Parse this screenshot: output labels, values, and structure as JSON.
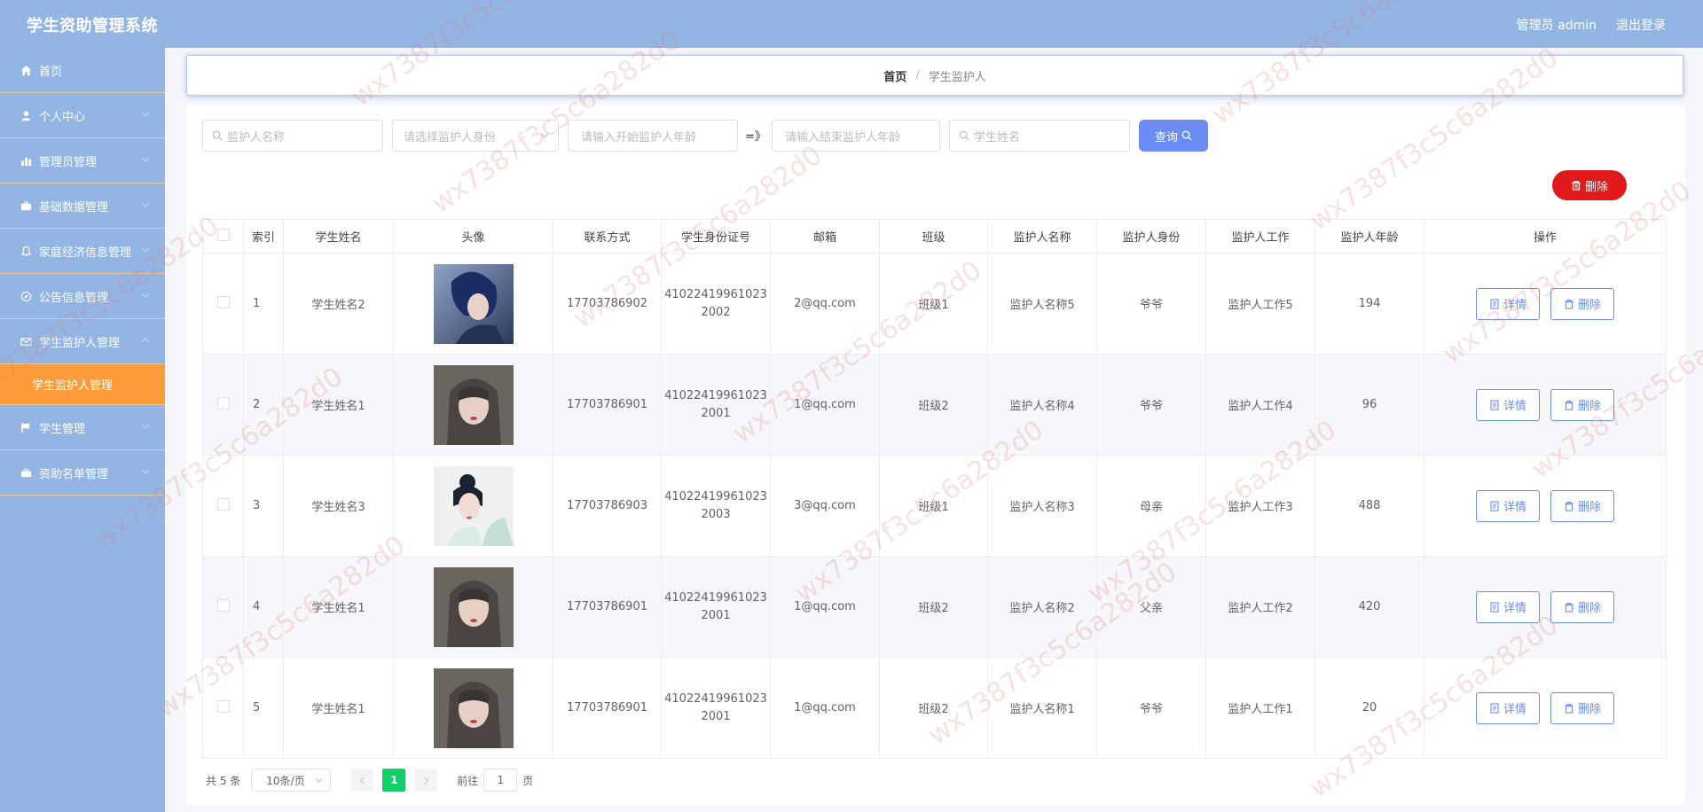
{
  "header": {
    "title": "学生资助管理系统",
    "user_label": "管理员 admin",
    "logout_label": "退出登录"
  },
  "sidebar": {
    "items": [
      {
        "label": "首页",
        "icon": "home-icon"
      },
      {
        "label": "个人中心",
        "icon": "user-icon"
      },
      {
        "label": "管理员管理",
        "icon": "bar-chart-icon"
      },
      {
        "label": "基础数据管理",
        "icon": "briefcase-icon"
      },
      {
        "label": "家庭经济信息管理",
        "icon": "bell-icon"
      },
      {
        "label": "公告信息管理",
        "icon": "compass-icon"
      },
      {
        "label": "学生监护人管理",
        "icon": "mail-icon"
      },
      {
        "label": "学生管理",
        "icon": "flag-icon"
      },
      {
        "label": "资助名单管理",
        "icon": "suitcase-icon"
      }
    ],
    "active_sub": "学生监护人管理"
  },
  "breadcrumb": {
    "home": "首页",
    "separator": "/",
    "current": "学生监护人"
  },
  "filters": {
    "guardian_name_placeholder": "监护人名称",
    "guardian_identity_placeholder": "请选择监护人身份",
    "age_start_placeholder": "请输入开始监护人年龄",
    "range_sep": "=》",
    "age_end_placeholder": "请输入结束监护人年龄",
    "student_name_placeholder": "学生姓名",
    "query_label": "查询"
  },
  "delete_label": "删除",
  "table": {
    "headers": [
      "索引",
      "学生姓名",
      "头像",
      "联系方式",
      "学生身份证号",
      "邮箱",
      "班级",
      "监护人名称",
      "监护人身份",
      "监护人工作",
      "监护人年龄",
      "操作"
    ],
    "detail_label": "详情",
    "delete_label": "删除",
    "rows": [
      {
        "index": "1",
        "student": "学生姓名2",
        "phone": "17703786902",
        "id_line1": "41022419961023",
        "id_line2": "2002",
        "email": "2@qq.com",
        "class": "班级1",
        "guardian": "监护人名称5",
        "identity": "爷爷",
        "job": "监护人工作5",
        "age": "194"
      },
      {
        "index": "2",
        "student": "学生姓名1",
        "phone": "17703786901",
        "id_line1": "41022419961023",
        "id_line2": "2001",
        "email": "1@qq.com",
        "class": "班级2",
        "guardian": "监护人名称4",
        "identity": "爷爷",
        "job": "监护人工作4",
        "age": "96"
      },
      {
        "index": "3",
        "student": "学生姓名3",
        "phone": "17703786903",
        "id_line1": "41022419961023",
        "id_line2": "2003",
        "email": "3@qq.com",
        "class": "班级1",
        "guardian": "监护人名称3",
        "identity": "母亲",
        "job": "监护人工作3",
        "age": "488"
      },
      {
        "index": "4",
        "student": "学生姓名1",
        "phone": "17703786901",
        "id_line1": "41022419961023",
        "id_line2": "2001",
        "email": "1@qq.com",
        "class": "班级2",
        "guardian": "监护人名称2",
        "identity": "父亲",
        "job": "监护人工作2",
        "age": "420"
      },
      {
        "index": "5",
        "student": "学生姓名1",
        "phone": "17703786901",
        "id_line1": "41022419961023",
        "id_line2": "2001",
        "email": "1@qq.com",
        "class": "班级2",
        "guardian": "监护人名称1",
        "identity": "爷爷",
        "job": "监护人工作1",
        "age": "20"
      }
    ]
  },
  "pagination": {
    "total_label": "共 5 条",
    "page_size": "10条/页",
    "current_page": "1",
    "goto_label": "前往",
    "goto_value": "1",
    "page_unit": "页"
  },
  "watermark": "wx7387f3c5c6a282d0",
  "colors": {
    "header_bg": "#92b5e3",
    "active_menu": "#fe9c3a",
    "primary": "#6b8bf5",
    "danger": "#e2191a",
    "pager_active": "#13ce66"
  }
}
